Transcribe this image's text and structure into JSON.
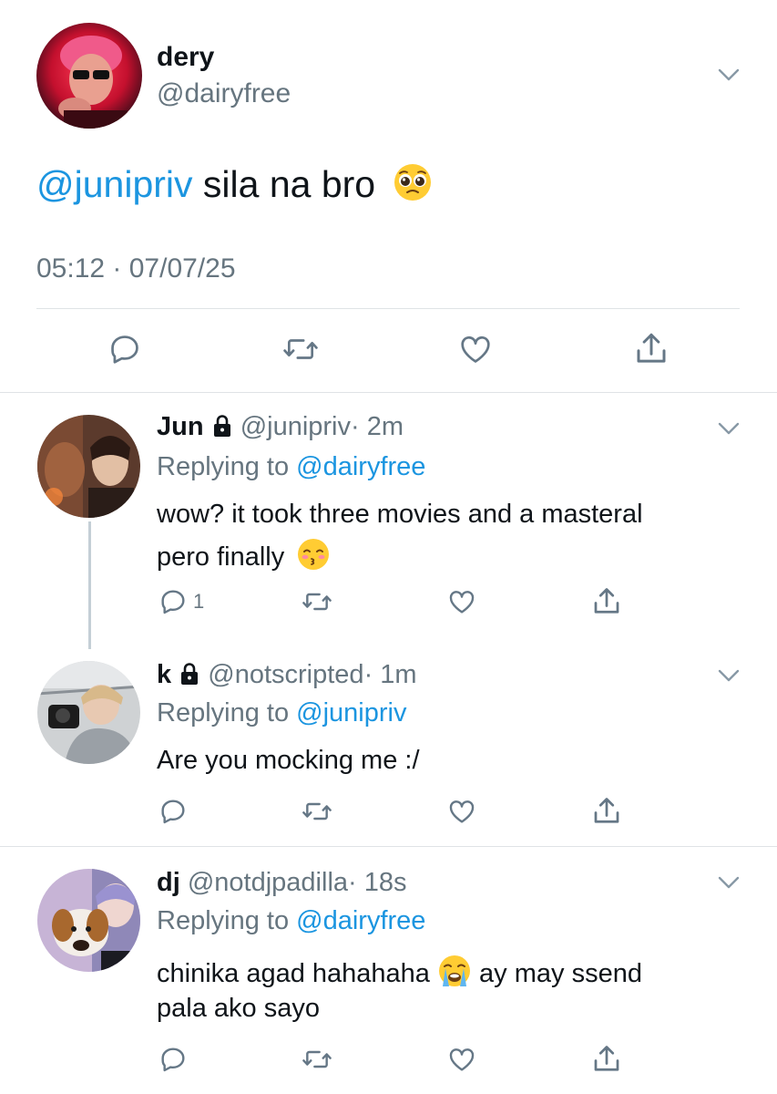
{
  "main_tweet": {
    "display_name": "dery",
    "handle": "@dairyfree",
    "mention": "@junipriv",
    "text": " sila na bro",
    "emoji": "pleading-face",
    "timestamp": "05:12 · 07/07/25"
  },
  "replies": [
    {
      "display_name": "Jun",
      "locked": true,
      "handle": "@junipriv",
      "time": "· 2m",
      "replying_prefix": "Replying to ",
      "replying_to": "@dairyfree",
      "line1": "wow? it took three movies and a masteral",
      "line2": "pero finally",
      "emoji": "kissing-face-with-closed-eyes",
      "reply_count": "1"
    },
    {
      "display_name": "k",
      "locked": true,
      "handle": "@notscripted",
      "time": "· 1m",
      "replying_prefix": "Replying to ",
      "replying_to": "@junipriv",
      "line1": "Are you mocking me :/"
    },
    {
      "display_name": "dj",
      "locked": false,
      "handle": "@notdjpadilla",
      "time": "· 18s",
      "replying_prefix": "Replying to ",
      "replying_to": "@dairyfree",
      "line1_a": "chinika agad hahahaha ",
      "line1_b": " ay may ssend",
      "line2": "pala ako sayo",
      "emoji": "loudly-crying-face"
    }
  ],
  "colors": {
    "link": "#1b95e0",
    "secondary_text": "#66757f",
    "divider": "#dfe3e6",
    "icon": "#657786"
  }
}
